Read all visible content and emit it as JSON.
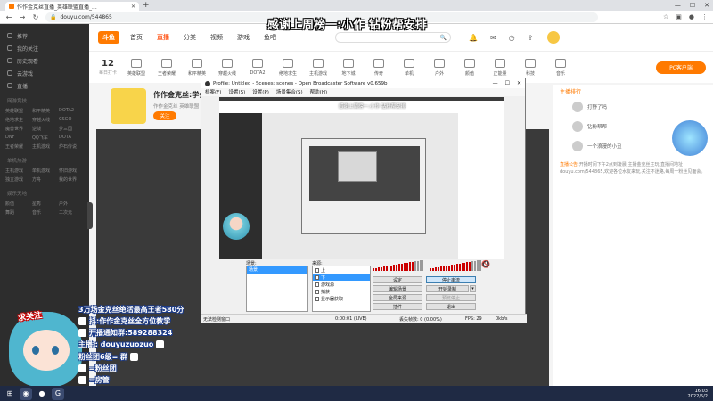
{
  "browser": {
    "tab_title": "作作金克丝直播_英雄联盟直播_...",
    "url": "douyu.com/544865"
  },
  "caption_top": "感谢上周榜一:小作   钻粉帮安排",
  "site": {
    "logo": "斗鱼",
    "nav": [
      "首页",
      "直播",
      "分类",
      "视频",
      "游戏",
      "鱼吧"
    ],
    "active_nav": "直播",
    "date_num": "12",
    "date_label": "每日打卡",
    "categories": [
      "英雄联盟",
      "王者荣耀",
      "和平精英",
      "穿越火线",
      "DOTA2",
      "绝地求生",
      "主机游戏",
      "地下城",
      "传奇",
      "单机",
      "户外",
      "颜值",
      "正能量",
      "科技",
      "音乐"
    ],
    "pc_button": "PC客户端",
    "sidebar": {
      "items": [
        "推荐",
        "我的关注",
        "历史观看",
        "云游戏",
        "直播"
      ],
      "section1": "网游竞技",
      "grid1": [
        "英雄联盟",
        "和平精英",
        "DOTA2",
        "绝地求生",
        "穿越火线",
        "CSGO",
        "魔兽世界",
        "逆战",
        "梦三国",
        "DNF",
        "QQ飞车",
        "DOTA",
        "王者荣耀",
        "主机游戏",
        "炉石传说"
      ],
      "section2": "单机热游",
      "grid2": [
        "主机游戏",
        "单机游戏",
        "怀旧游戏",
        "独立游戏",
        "方舟",
        "我的世界"
      ],
      "section3": "娱乐天地",
      "grid3": [
        "颜值",
        "星秀",
        "户外",
        "舞蹈",
        "音乐",
        "二次元"
      ]
    }
  },
  "room": {
    "title": "作作金克丝:学会金克丝教学",
    "tag": "作作金克丝  英雄联盟  LOL  直播  排位",
    "follow": "关注"
  },
  "right_panel": {
    "head": "主播排行",
    "ranks": [
      "打野了吗",
      "钻粉帮帮",
      "一个浪漫的小丑"
    ],
    "notice_label": "直播公告:",
    "notice": "开播时间下午2点到凌晨,主播金克丝主玩,直播间地址douyu.com/544865,欢迎各位水友来玩,关注不迷路,每周一粉丝见面会。"
  },
  "obs": {
    "title": "Profile: Untitled - Scenes: scenes - Open Broadcaster Software v0.659b",
    "menu": [
      "档案(F)",
      "设置(S)",
      "设置(P)",
      "场景集合(S)",
      "帮助(H)"
    ],
    "preview_caption": "感谢上周榜一:小作   钻粉帮安排",
    "scenes_label": "场景:",
    "sources_label": "来源:",
    "scene_items": [
      "场景"
    ],
    "source_items": [
      {
        "label": "上",
        "checked": true
      },
      {
        "label": "下",
        "checked": true
      },
      {
        "label": "游戏源",
        "checked": true
      },
      {
        "label": "捕获",
        "checked": true
      },
      {
        "label": "显示器获取",
        "checked": true
      }
    ],
    "buttons": {
      "settings": "设定",
      "stop_stream": "停止串流",
      "edit_scene": "编辑场景",
      "start_record": "开始录制",
      "global_sources": "全局来源",
      "plugins": "插件",
      "exit": "退出",
      "stop_preview": "预览停止"
    },
    "status": {
      "left": "无法检测窗口",
      "time": "0:00:01 (LIVE)",
      "dropped": "丢失帧数: 0 (0.00%)",
      "fps": "FPS: 29",
      "bitrate": "0kb/s"
    }
  },
  "overlay": {
    "streamer_tag": "求关注",
    "lines": [
      {
        "text": "3万场金克丝绝活最高王者580分",
        "icon": "none"
      },
      {
        "text": "抖:作作金克丝全方位教学",
        "icon": "tiktok-icon"
      },
      {
        "text": "开播通知群:589288324",
        "icon": "qq-icon"
      },
      {
        "text": "主播    : douyuzuozuo",
        "icon": "wechat-icon"
      },
      {
        "text": "粉丝团6级=    群",
        "icon": "wechat-icon"
      },
      {
        "text": "=粉丝团",
        "icon": "badge-icon"
      },
      {
        "text": "=房管",
        "icon": "badge-icon"
      }
    ]
  },
  "taskbar": {
    "time": "16:03",
    "date": "2022/5/2"
  }
}
